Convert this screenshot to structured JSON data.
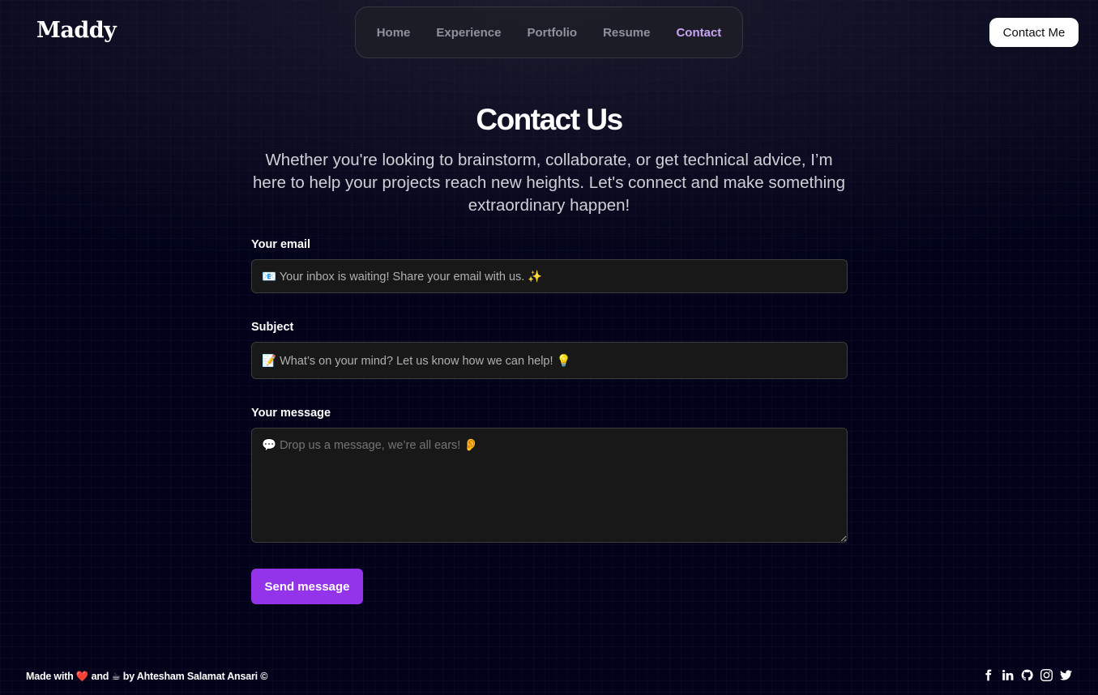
{
  "header": {
    "logo": "Maddy",
    "nav": [
      {
        "label": "Home",
        "active": false
      },
      {
        "label": "Experience",
        "active": false
      },
      {
        "label": "Portfolio",
        "active": false
      },
      {
        "label": "Resume",
        "active": false
      },
      {
        "label": "Contact",
        "active": true
      }
    ],
    "cta_label": "Contact Me"
  },
  "hero": {
    "title": "Contact Us",
    "subtitle": "Whether you're looking to brainstorm, collaborate, or get technical advice, I’m here to help your projects reach new heights. Let's connect and make something extraordinary happen!"
  },
  "form": {
    "email_label": "Your email",
    "email_placeholder": "📧 Your inbox is waiting! Share your email with us. ✨",
    "subject_label": "Subject",
    "subject_placeholder": "📝 What’s on your mind? Let us know how we can help! 💡",
    "message_label": "Your message",
    "message_placeholder": "💬 Drop us a message, we’re all ears! 👂",
    "submit_label": "Send message"
  },
  "footer": {
    "made_with": "Made with",
    "heart": "❤️",
    "and": "and",
    "coffee": "☕",
    "by": "by Ahtesham Salamat Ansari ©",
    "socials": [
      "facebook-icon",
      "linkedin-icon",
      "github-icon",
      "instagram-icon",
      "twitter-icon"
    ]
  },
  "colors": {
    "background": "#02031a",
    "accent": "#9333ea",
    "nav_active": "#c9a4f5"
  }
}
